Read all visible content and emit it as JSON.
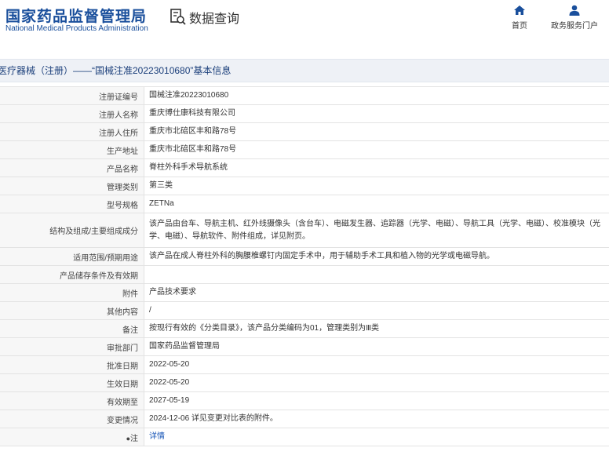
{
  "header": {
    "logo_cn": "国家药品监督管理局",
    "logo_en": "National Medical Products Administration",
    "search_title": "数据查询",
    "nav": [
      {
        "label": "首页",
        "icon": "home-icon"
      },
      {
        "label": "政务服务门户",
        "icon": "user-icon"
      }
    ]
  },
  "title": "医疗器械（注册）——“国械注准20223010680”基本信息",
  "rows": [
    {
      "label": "注册证编号",
      "value": "国械注准20223010680"
    },
    {
      "label": "注册人名称",
      "value": "重庆博仕康科技有限公司"
    },
    {
      "label": "注册人住所",
      "value": "重庆市北碚区丰和路78号"
    },
    {
      "label": "生产地址",
      "value": "重庆市北碚区丰和路78号"
    },
    {
      "label": "产品名称",
      "value": "脊柱外科手术导航系统"
    },
    {
      "label": "管理类别",
      "value": "第三类"
    },
    {
      "label": "型号规格",
      "value": "ZETNa"
    },
    {
      "label": "结构及组成/主要组成成分",
      "value": "该产品由台车、导航主机、红外线摄像头（含台车）、电磁发生器、追踪器（光学、电磁）、导航工具（光学、电磁）、校准模块（光学、电磁）、导航软件、附件组成，详见附页。"
    },
    {
      "label": "适用范围/预期用途",
      "value": "该产品在成人脊柱外科的胸腰椎螺钉内固定手术中，用于辅助手术工具和植入物的光学或电磁导航。"
    },
    {
      "label": "产品储存条件及有效期",
      "value": ""
    },
    {
      "label": "附件",
      "value": "产品技术要求"
    },
    {
      "label": "其他内容",
      "value": "/"
    },
    {
      "label": "备注",
      "value": "按现行有效的《分类目录》，该产品分类编码为01，管理类别为Ⅲ类"
    },
    {
      "label": "审批部门",
      "value": "国家药品监督管理局"
    },
    {
      "label": "批准日期",
      "value": "2022-05-20"
    },
    {
      "label": "生效日期",
      "value": "2022-05-20"
    },
    {
      "label": "有效期至",
      "value": "2027-05-19"
    },
    {
      "label": "变更情况",
      "value": "2024-12-06 详见变更对比表的附件。"
    }
  ],
  "note": {
    "label": "注",
    "link": "详情",
    "icon": "location-pin-icon"
  }
}
